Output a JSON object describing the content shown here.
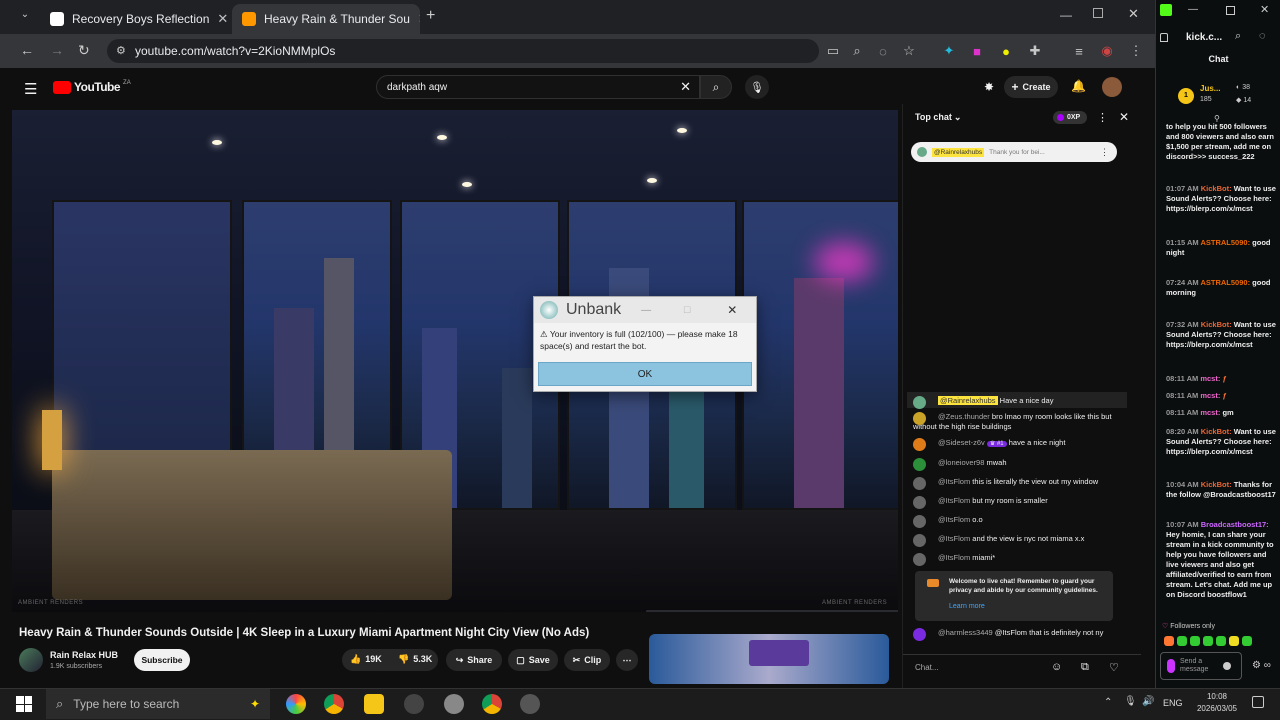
{
  "browser": {
    "tabs": [
      {
        "title": "Recovery Boys Reflection",
        "color": "#ffffff"
      },
      {
        "title": "Heavy Rain & Thunder Sou",
        "color": "#ff0000"
      }
    ],
    "url": "youtube.com/watch?v=2KioNMMplOs"
  },
  "youtube": {
    "logo": "YouTube",
    "country": "ZA",
    "search_value": "darkpath aqw",
    "create_label": "Create",
    "video_title": "Heavy Rain & Thunder Sounds Outside | 4K Sleep in a Luxury Miami Apartment Night City View (No Ads)",
    "channel_name": "Rain Relax HUB",
    "subscribers": "1.9K subscribers",
    "subscribe_label": "Subscribe",
    "likes": "19K",
    "dislikes": "5.3K",
    "share_label": "Share",
    "save_label": "Save",
    "clip_label": "Clip",
    "watermark_left": "AMBIENT RENDERS",
    "watermark_right": "AMBIENT RENDERS"
  },
  "dialog": {
    "title": "Unbank",
    "message": "Your inventory is full (102/100) — please make 18 space(s) and restart the bot.",
    "ok_label": "OK"
  },
  "ytchat": {
    "header": "Top chat",
    "xp_badge": "0XP",
    "pinned_user": "@Rainrelaxhubs",
    "pinned_text": "Thank you for bei...",
    "messages": [
      {
        "user": "@Rainrelaxhubs",
        "text": "Have a nice day",
        "avatar": "#6a8"
      },
      {
        "user": "@Zeus.thunder",
        "text": "bro lmao my room looks like this but without the high rise buildings",
        "avatar": "#c9a227"
      },
      {
        "user": "@Sideset-z6v",
        "text": "have a nice night",
        "avatar": "#e07b1a"
      },
      {
        "user": "@loneiover98",
        "text": "mwah",
        "avatar": "#2c8f3a"
      },
      {
        "user": "@ItsFlom",
        "text": "this is literally the view out my window",
        "avatar": "#666"
      },
      {
        "user": "@ItsFlom",
        "text": "but my room is smaller",
        "avatar": "#666"
      },
      {
        "user": "@ItsFlom",
        "text": "o.o",
        "avatar": "#666"
      },
      {
        "user": "@ItsFlom",
        "text": "and the view is nyc not miama x.x",
        "avatar": "#666"
      },
      {
        "user": "@ItsFlom",
        "text": "miami*",
        "avatar": "#666"
      }
    ],
    "welcome": "Welcome to live chat! Remember to guard your privacy and abide by our community guidelines.",
    "learn_more": "Learn more",
    "last_user": "@harmless3449",
    "last_text": "@ItsFlom that is definitely not ny",
    "input_placeholder": "Chat..."
  },
  "kick": {
    "url": "kick.c...",
    "chat_title": "Chat",
    "user_short": "Jus...",
    "stat1": "38",
    "stat2": "185",
    "stat3": "14",
    "followers_only": "Followers only",
    "send_placeholder": "Send a message",
    "messages": [
      {
        "time": "",
        "user": "",
        "text": "to help you hit 500 followers and 800 viewers and also earn $1,500 per stream, add me on discord>>> success_222"
      },
      {
        "time": "01:07 AM",
        "user": "KickBot:",
        "text": "Want to use Sound Alerts?? Choose here: https://blerp.com/x/mcst"
      },
      {
        "time": "01:15 AM",
        "user": "ASTRAL5090:",
        "text": "good night"
      },
      {
        "time": "07:24 AM",
        "user": "ASTRAL5090:",
        "text": "good morning"
      },
      {
        "time": "07:32 AM",
        "user": "KickBot:",
        "text": "Want to use Sound Alerts?? Choose here: https://blerp.com/x/mcst"
      },
      {
        "time": "08:11 AM",
        "user": "mcst:",
        "text": ""
      },
      {
        "time": "08:11 AM",
        "user": "mcst:",
        "text": ""
      },
      {
        "time": "08:11 AM",
        "user": "mcst:",
        "text": "gm"
      },
      {
        "time": "08:20 AM",
        "user": "KickBot:",
        "text": "Want to use Sound Alerts?? Choose here: https://blerp.com/x/mcst"
      },
      {
        "time": "10:04 AM",
        "user": "KickBot:",
        "text": "Thanks for the follow @Broadcastboost17"
      },
      {
        "time": "10:07 AM",
        "user": "Broadcastboost17:",
        "text": "Hey homie, I can share your stream in a kick community to help you have followers and live viewers and also get affiliated/verified to earn from stream. Let's chat. Add me up on Discord boostflow1"
      }
    ]
  },
  "taskbar": {
    "search_placeholder": "Type here to search",
    "lang": "ENG",
    "time": "10:08",
    "date": "2026/03/05"
  }
}
